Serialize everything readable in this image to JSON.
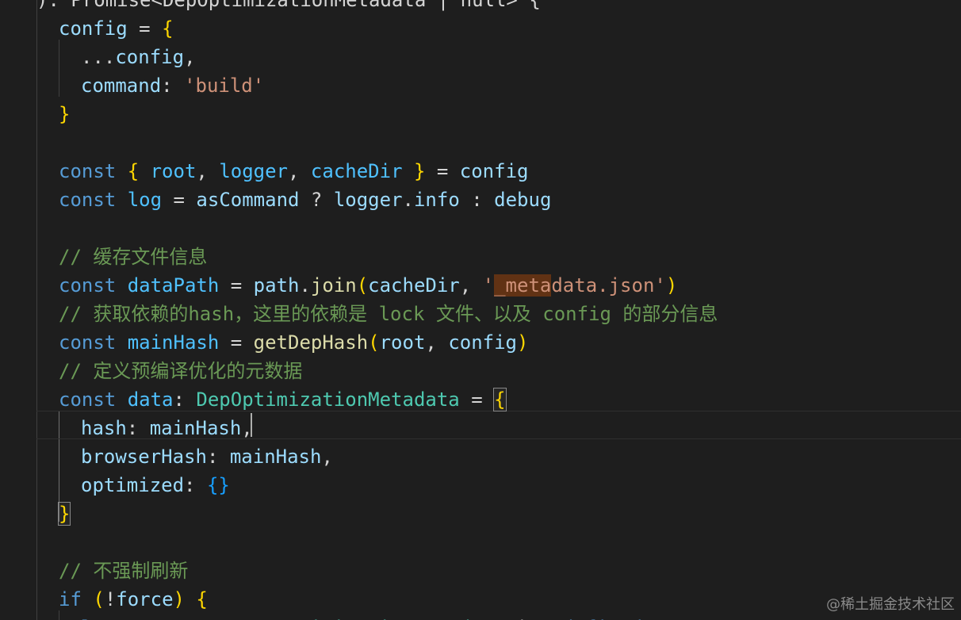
{
  "editor": {
    "lines": [
      {
        "row": 0,
        "tokens": [
          {
            "t": "): Promise<DepOptimizationMetadata | null> {",
            "c": "p"
          }
        ]
      },
      {
        "row": 1,
        "indent": 0,
        "tokens": [
          {
            "t": "config",
            "c": "var"
          },
          {
            "t": " = ",
            "c": "p"
          },
          {
            "t": "{",
            "c": "b1"
          }
        ]
      },
      {
        "row": 2,
        "indent": 1,
        "tokens": [
          {
            "t": "...",
            "c": "p"
          },
          {
            "t": "config",
            "c": "var"
          },
          {
            "t": ",",
            "c": "p"
          }
        ]
      },
      {
        "row": 3,
        "indent": 1,
        "tokens": [
          {
            "t": "command",
            "c": "var"
          },
          {
            "t": ": ",
            "c": "p"
          },
          {
            "t": "'build'",
            "c": "str"
          }
        ]
      },
      {
        "row": 4,
        "indent": 0,
        "tokens": [
          {
            "t": "}",
            "c": "b1"
          }
        ]
      },
      {
        "row": 6,
        "indent": 0,
        "tokens": [
          {
            "t": "const",
            "c": "kw"
          },
          {
            "t": " ",
            "c": "p"
          },
          {
            "t": "{",
            "c": "b1"
          },
          {
            "t": " root",
            "c": "cvar"
          },
          {
            "t": ", ",
            "c": "p"
          },
          {
            "t": "logger",
            "c": "cvar"
          },
          {
            "t": ", ",
            "c": "p"
          },
          {
            "t": "cacheDir",
            "c": "cvar"
          },
          {
            "t": " ",
            "c": "p"
          },
          {
            "t": "}",
            "c": "b1"
          },
          {
            "t": " = ",
            "c": "p"
          },
          {
            "t": "config",
            "c": "var"
          }
        ]
      },
      {
        "row": 7,
        "indent": 0,
        "tokens": [
          {
            "t": "const",
            "c": "kw"
          },
          {
            "t": " ",
            "c": "p"
          },
          {
            "t": "log",
            "c": "cvar"
          },
          {
            "t": " = ",
            "c": "p"
          },
          {
            "t": "asCommand",
            "c": "var"
          },
          {
            "t": " ? ",
            "c": "p"
          },
          {
            "t": "logger",
            "c": "var"
          },
          {
            "t": ".",
            "c": "p"
          },
          {
            "t": "info",
            "c": "var"
          },
          {
            "t": " : ",
            "c": "p"
          },
          {
            "t": "debug",
            "c": "var"
          }
        ]
      },
      {
        "row": 9,
        "indent": 0,
        "tokens": [
          {
            "t": "// 缓存文件信息",
            "c": "cmt"
          }
        ]
      },
      {
        "row": 10,
        "indent": 0,
        "tokens": [
          {
            "t": "const",
            "c": "kw"
          },
          {
            "t": " ",
            "c": "p"
          },
          {
            "t": "dataPath",
            "c": "cvar"
          },
          {
            "t": " = ",
            "c": "p"
          },
          {
            "t": "path",
            "c": "var"
          },
          {
            "t": ".",
            "c": "p"
          },
          {
            "t": "join",
            "c": "fn"
          },
          {
            "t": "(",
            "c": "b1"
          },
          {
            "t": "cacheDir",
            "c": "var"
          },
          {
            "t": ", ",
            "c": "p"
          },
          {
            "t": "'",
            "c": "str"
          },
          {
            "t": "_meta",
            "c": "str",
            "hl": "find"
          },
          {
            "t": "data.json'",
            "c": "str"
          },
          {
            "t": ")",
            "c": "b1"
          }
        ]
      },
      {
        "row": 11,
        "indent": 0,
        "tokens": [
          {
            "t": "// 获取依赖的hash，这里的依赖是 lock 文件、以及 config 的部分信息",
            "c": "cmt"
          }
        ]
      },
      {
        "row": 12,
        "indent": 0,
        "tokens": [
          {
            "t": "const",
            "c": "kw"
          },
          {
            "t": " ",
            "c": "p"
          },
          {
            "t": "mainHash",
            "c": "cvar"
          },
          {
            "t": " = ",
            "c": "p"
          },
          {
            "t": "getDepHash",
            "c": "fn"
          },
          {
            "t": "(",
            "c": "b1"
          },
          {
            "t": "root",
            "c": "var"
          },
          {
            "t": ", ",
            "c": "p"
          },
          {
            "t": "config",
            "c": "var"
          },
          {
            "t": ")",
            "c": "b1"
          }
        ]
      },
      {
        "row": 13,
        "indent": 0,
        "tokens": [
          {
            "t": "// 定义预编译优化的元数据",
            "c": "cmt"
          }
        ]
      },
      {
        "row": 14,
        "indent": 0,
        "tokens": [
          {
            "t": "const",
            "c": "kw"
          },
          {
            "t": " ",
            "c": "p"
          },
          {
            "t": "data",
            "c": "cvar"
          },
          {
            "t": ": ",
            "c": "p"
          },
          {
            "t": "DepOptimizationMetadata",
            "c": "type"
          },
          {
            "t": " = ",
            "c": "p"
          },
          {
            "t": "{",
            "c": "b1",
            "hl": "bracket"
          }
        ]
      },
      {
        "row": 15,
        "indent": 1,
        "tokens": [
          {
            "t": "hash",
            "c": "var"
          },
          {
            "t": ": ",
            "c": "p"
          },
          {
            "t": "mainHash",
            "c": "var"
          },
          {
            "t": ",",
            "c": "p"
          }
        ]
      },
      {
        "row": 16,
        "indent": 1,
        "tokens": [
          {
            "t": "browserHash",
            "c": "var"
          },
          {
            "t": ": ",
            "c": "p"
          },
          {
            "t": "mainHash",
            "c": "var"
          },
          {
            "t": ",",
            "c": "p"
          }
        ]
      },
      {
        "row": 17,
        "indent": 1,
        "tokens": [
          {
            "t": "optimized",
            "c": "var"
          },
          {
            "t": ": ",
            "c": "p"
          },
          {
            "t": "{}",
            "c": "b3"
          }
        ]
      },
      {
        "row": 18,
        "indent": 0,
        "tokens": [
          {
            "t": "}",
            "c": "b1",
            "hl": "bracket"
          }
        ]
      },
      {
        "row": 20,
        "indent": 0,
        "tokens": [
          {
            "t": "// 不强制刷新",
            "c": "cmt"
          }
        ]
      },
      {
        "row": 21,
        "indent": 0,
        "tokens": [
          {
            "t": "if",
            "c": "kw"
          },
          {
            "t": " ",
            "c": "p"
          },
          {
            "t": "(",
            "c": "b1"
          },
          {
            "t": "!",
            "c": "p"
          },
          {
            "t": "force",
            "c": "var"
          },
          {
            "t": ")",
            "c": "b1"
          },
          {
            "t": " ",
            "c": "p"
          },
          {
            "t": "{",
            "c": "b1"
          }
        ]
      },
      {
        "row": 22,
        "indent": 1,
        "tokens": [
          {
            "t": "let",
            "c": "kw"
          },
          {
            "t": " ",
            "c": "p"
          },
          {
            "t": "prevData",
            "c": "var"
          },
          {
            "t": ": ",
            "c": "p"
          },
          {
            "t": "DepOptimizationMetadata",
            "c": "type"
          },
          {
            "t": " | ",
            "c": "p"
          },
          {
            "t": "undefined",
            "c": "kw"
          }
        ]
      }
    ]
  },
  "watermark": "@稀土掘金技术社区"
}
